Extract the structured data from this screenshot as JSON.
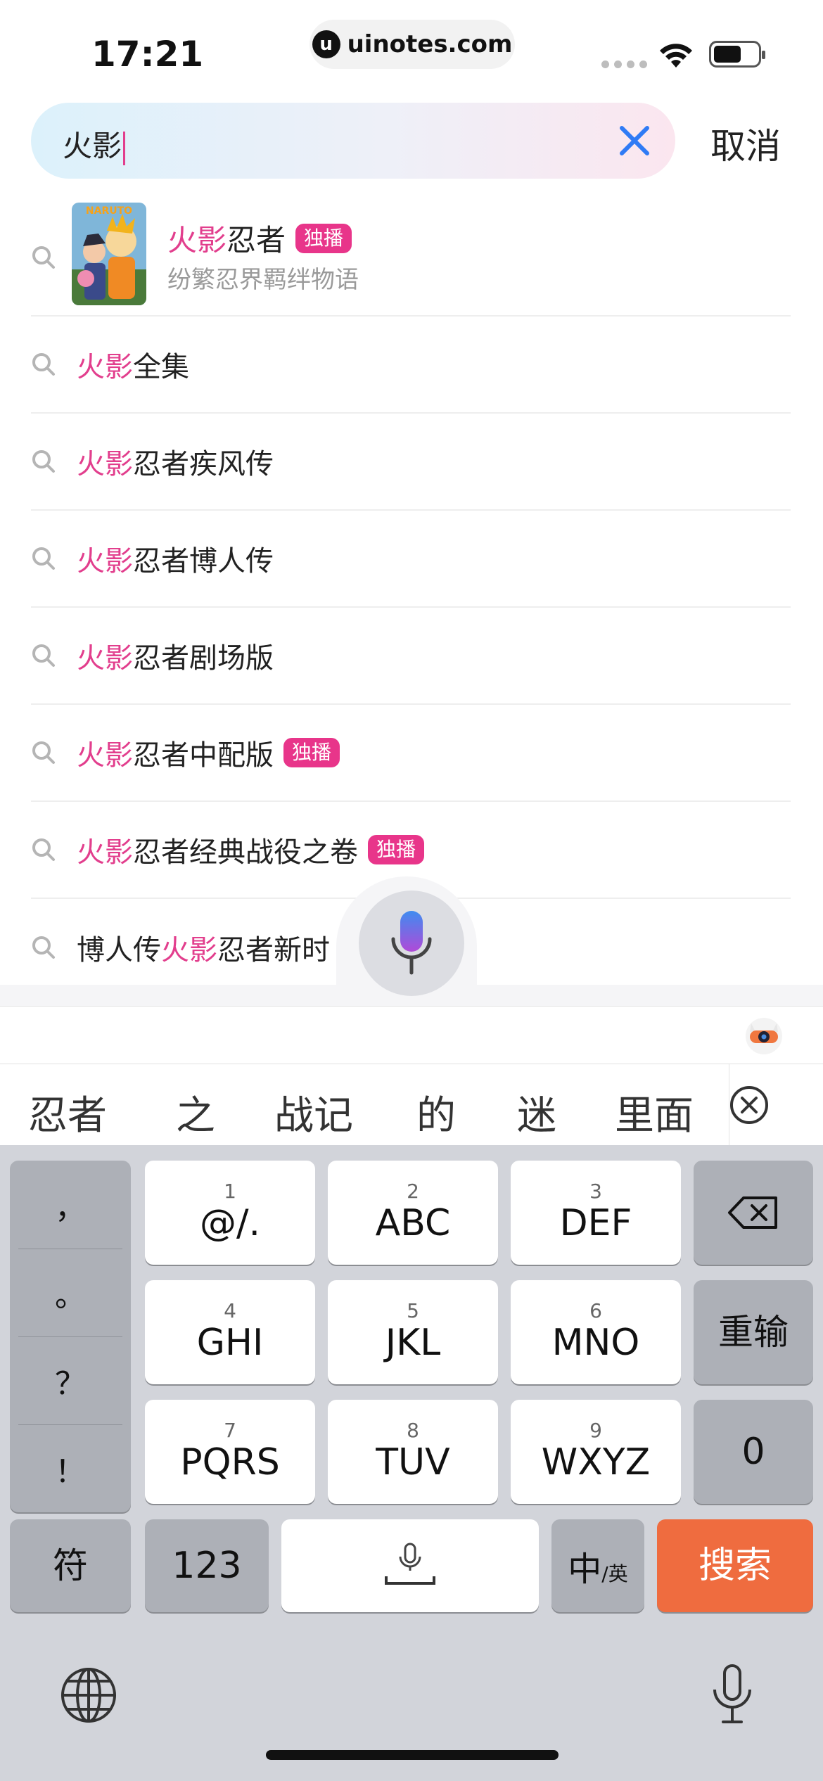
{
  "status_bar": {
    "time": "17:21",
    "url": "uinotes.com",
    "url_logo": "u"
  },
  "search": {
    "query": "火影",
    "cancel_label": "取消"
  },
  "suggestions": {
    "featured": {
      "title_highlight": "火影",
      "title_rest": "忍者",
      "badge": "独播",
      "subtitle": "纷繁忍界羁绊物语",
      "poster_text": "NARUTO"
    },
    "items": [
      {
        "pre": "",
        "hl": "火影",
        "post": "全集",
        "badge": ""
      },
      {
        "pre": "",
        "hl": "火影",
        "post": "忍者疾风传",
        "badge": ""
      },
      {
        "pre": "",
        "hl": "火影",
        "post": "忍者博人传",
        "badge": ""
      },
      {
        "pre": "",
        "hl": "火影",
        "post": "忍者剧场版",
        "badge": ""
      },
      {
        "pre": "",
        "hl": "火影",
        "post": "忍者中配版",
        "badge": "独播"
      },
      {
        "pre": "",
        "hl": "火影",
        "post": "忍者经典战役之卷",
        "badge": "独播"
      },
      {
        "pre": "博人传",
        "hl": "火影",
        "post": "忍者新时",
        "badge": ""
      }
    ]
  },
  "candidates": [
    "忍者",
    "之",
    "战记",
    "的",
    "迷",
    "里面"
  ],
  "keyboard": {
    "punctuation": [
      "，",
      "。",
      "？",
      "！"
    ],
    "keys": [
      {
        "num": "1",
        "label": "@/."
      },
      {
        "num": "2",
        "label": "ABC"
      },
      {
        "num": "3",
        "label": "DEF"
      },
      {
        "num": "4",
        "label": "GHI"
      },
      {
        "num": "5",
        "label": "JKL"
      },
      {
        "num": "6",
        "label": "MNO"
      },
      {
        "num": "7",
        "label": "PQRS"
      },
      {
        "num": "8",
        "label": "TUV"
      },
      {
        "num": "9",
        "label": "WXYZ"
      }
    ],
    "reinput_label": "重输",
    "zero_label": "0",
    "symbols_label": "符",
    "numbers_label": "123",
    "lang_main": "中",
    "lang_sub": "/英",
    "search_label": "搜索"
  },
  "colors": {
    "highlight": "#e23e8d",
    "badge": "#e8358a",
    "search_key": "#ef6c3f",
    "clear_icon": "#2f7bf5"
  }
}
